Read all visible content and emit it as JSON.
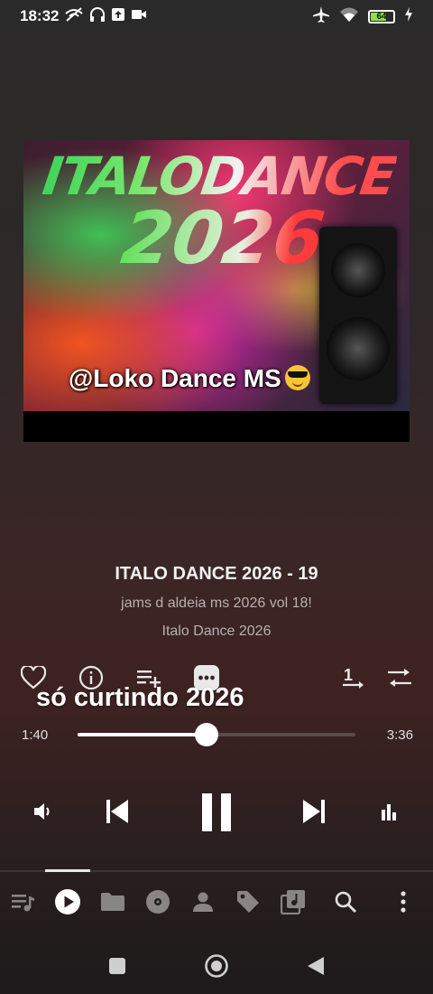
{
  "status_bar": {
    "time": "18:32",
    "battery_level": "64",
    "icons": [
      "wifi-calling-off-icon",
      "headphones-icon",
      "upload-icon",
      "video-icon",
      "airplane-icon",
      "wifi-icon",
      "battery-icon",
      "charging-icon"
    ]
  },
  "artwork": {
    "title_line1": "ITALODANCE",
    "title_line2": "2026",
    "handle": "@Loko Dance MS"
  },
  "track": {
    "title": "ITALO DANCE 2026 - 19",
    "subtitle": "jams d aldeia ms 2026 vol 18!",
    "album": "Italo Dance 2026"
  },
  "lyrics_line": "só curtindo 2026",
  "playback": {
    "current_time": "1:40",
    "total_time": "3:36",
    "progress": 0.463,
    "state": "playing"
  },
  "actions": [
    "favorite-icon",
    "info-icon",
    "add-to-queue-icon",
    "more-options-icon",
    "repeat-one-icon",
    "shuffle-icon"
  ],
  "bottom_nav": {
    "tabs": [
      "queue",
      "now-playing",
      "folders",
      "albums",
      "artists",
      "tags",
      "playlists",
      "search",
      "more"
    ],
    "active": "now-playing"
  },
  "colors": {
    "accent": "#ffffff",
    "muted_text": "#b7b0b0",
    "nav_inactive": "#8a8585",
    "battery_fill": "#8ee04a"
  }
}
